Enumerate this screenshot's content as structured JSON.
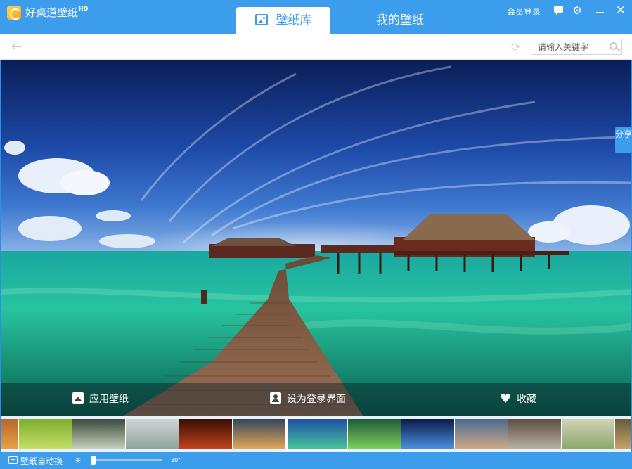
{
  "app": {
    "title": "好桌道壁纸",
    "title_sup": "HD"
  },
  "tabs": [
    {
      "label": "壁纸库",
      "active": true
    },
    {
      "label": "我的壁纸",
      "active": false
    }
  ],
  "titlebar": {
    "login_label": "会员登录",
    "icons": [
      "chat-icon",
      "gear-icon",
      "minimize-icon",
      "close-icon"
    ]
  },
  "toolbar": {
    "back_icon": "arrow-left-icon",
    "refresh_icon": "refresh-icon",
    "search": {
      "placeholder": "请输入关键字",
      "value": ""
    }
  },
  "share": {
    "label": "分享"
  },
  "actions": [
    {
      "label": "应用壁纸",
      "icon": "picture-icon"
    },
    {
      "label": "设为登录界面",
      "icon": "user-icon"
    },
    {
      "label": "收藏",
      "icon": "heart-icon"
    }
  ],
  "thumbnails": {
    "count": 13,
    "selected_index": 6,
    "colors": [
      [
        "#b8672a",
        "#e7a24a"
      ],
      [
        "#7fae2c",
        "#c5e06a"
      ],
      [
        "#3b4a3a",
        "#c8d3c0"
      ],
      [
        "#cfd6d4",
        "#8fa39b"
      ],
      [
        "#3a0d05",
        "#c2451c"
      ],
      [
        "#34455a",
        "#e6a85a"
      ],
      [
        "#1d4fa7",
        "#47c79a"
      ],
      [
        "#1d5b37",
        "#7fd25a"
      ],
      [
        "#0b1a4a",
        "#4a93e0"
      ],
      [
        "#4a6b90",
        "#d1a985"
      ],
      [
        "#5e4e43",
        "#b8b2a8"
      ],
      [
        "#d2d2b6",
        "#8aa66a"
      ],
      [
        "#6a5a3a",
        "#c7a46a"
      ]
    ]
  },
  "statusbar": {
    "auto_change_label": "壁纸自动换",
    "slider_min_label": "天",
    "slider_max_label": "30\"",
    "slider_value_fraction": 0.02
  },
  "colors": {
    "accent": "#3d9ded",
    "toolbar_bg": "#ffffff",
    "action_text": "#ffffff"
  }
}
